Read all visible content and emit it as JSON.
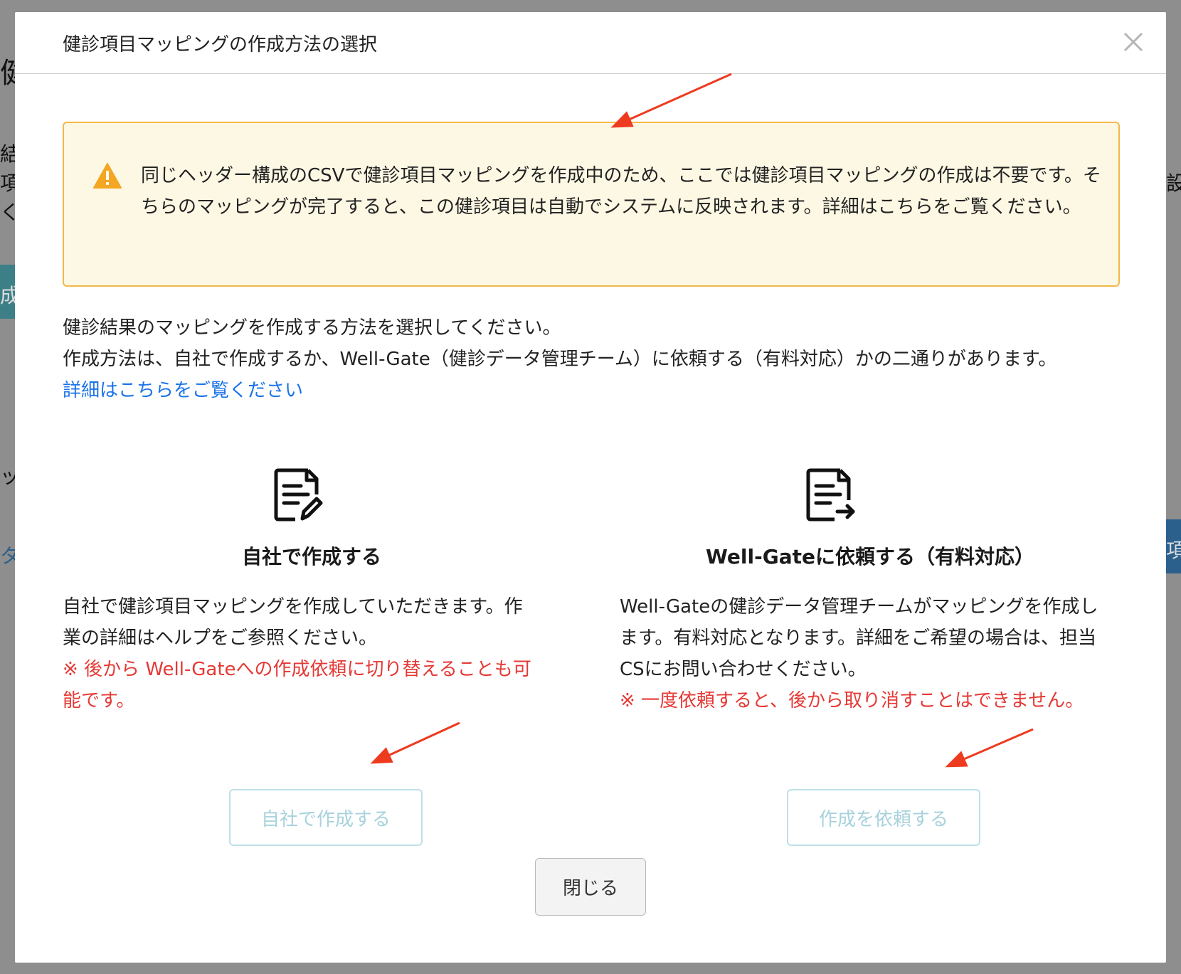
{
  "background": {
    "fragments": [
      "健診",
      "結",
      "項",
      "く",
      "成",
      "設",
      "ッ",
      "項",
      "タ_"
    ]
  },
  "modal": {
    "title": "健診項目マッピングの作成方法の選択",
    "close_icon": "close-icon"
  },
  "alert": {
    "icon": "warning-icon",
    "text": "同じヘッダー構成のCSVで健診項目マッピングを作成中のため、ここでは健診項目マッピングの作成は不要です。そちらのマッピングが完了すると、この健診項目は自動でシステムに反映されます。詳細はこちらをご覧ください。"
  },
  "description": {
    "line1": "健診結果のマッピングを作成する方法を選択してください。",
    "line2": "作成方法は、自社で作成するか、Well-Gate（健診データ管理チーム）に依頼する（有料対応）かの二通りがあります。",
    "link": "詳細はこちらをご覧ください"
  },
  "options": {
    "self": {
      "icon": "document-edit-icon",
      "title": "自社で作成する",
      "body": "自社で健診項目マッピングを作成していただきます。作業の詳細はヘルプをご参照ください。",
      "note": "※ 後から Well-Gateへの作成依頼に切り替えることも可能です。",
      "button": "自社で作成する"
    },
    "request": {
      "icon": "document-export-icon",
      "title": "Well-Gateに依頼する（有料対応）",
      "body": "Well-Gateの健診データ管理チームがマッピングを作成します。有料対応となります。詳細をご希望の場合は、担当CSにお問い合わせください。",
      "note": "※ 一度依頼すると、後から取り消すことはできません。",
      "button": "作成を依頼する"
    }
  },
  "footer": {
    "close_button": "閉じる"
  },
  "colors": {
    "alert_bg": "#fdf8e4",
    "alert_border": "#f3b84a",
    "warning": "#f5a623",
    "link": "#1a73e8",
    "note": "#e53935",
    "disabled_button_text": "#a8d2dc",
    "annotation_arrow": "#ee3a1f"
  }
}
